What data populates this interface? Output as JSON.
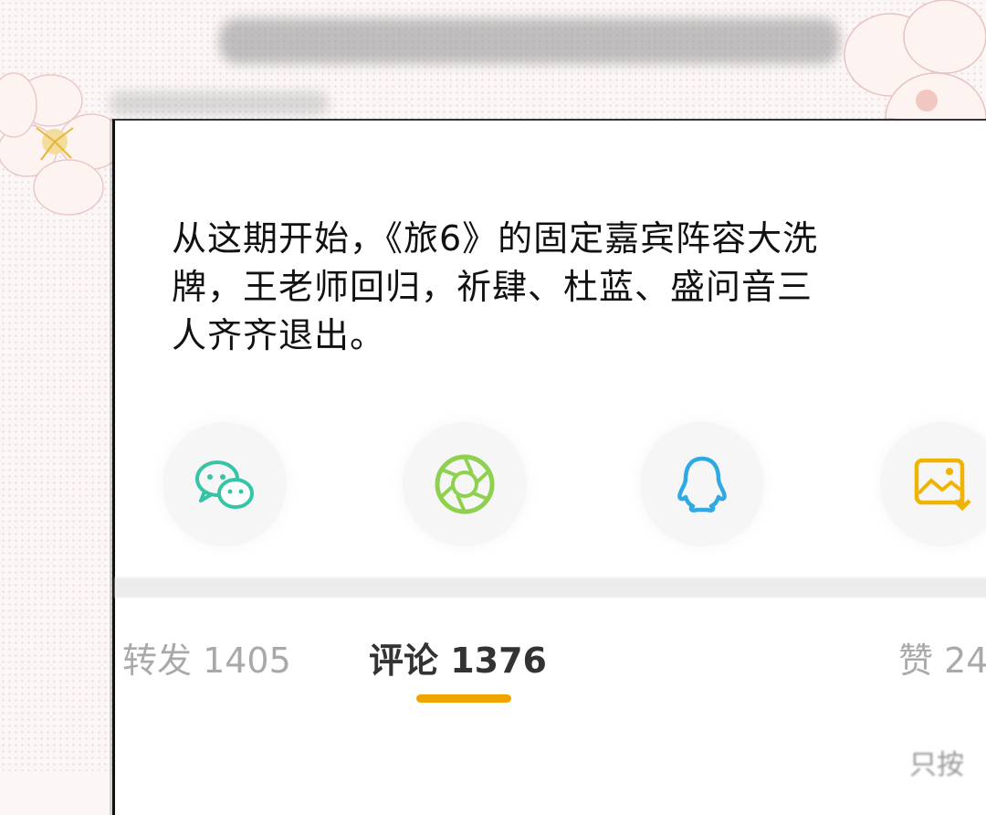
{
  "post": {
    "text": "从这期开始，《旅6》的固定嘉宾阵容大洗\n牌，王老师回归，祈肆、杜蓝、盛问音三\n人齐齐退出。"
  },
  "share": [
    {
      "name": "wechat",
      "icon": "wechat-icon",
      "color": "#35c4a6"
    },
    {
      "name": "moments",
      "icon": "moments-icon",
      "color": "#8fd04e"
    },
    {
      "name": "qq",
      "icon": "qq-icon",
      "color": "#2fa9e4"
    },
    {
      "name": "save-image",
      "icon": "save-image-icon",
      "color": "#f0b400"
    }
  ],
  "tabs": {
    "repost": "转发 1405",
    "comment": "评论 1376",
    "like": "赞 24"
  },
  "bottom_hint": "只按"
}
